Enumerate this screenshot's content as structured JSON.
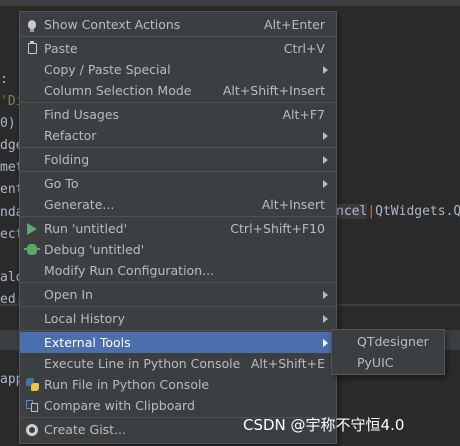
{
  "background": {
    "code_lines": [
      ":",
      "'Di",
      "0)",
      "dge",
      "met",
      "ent",
      "nda",
      "ect",
      "",
      "alo",
      "ed."
    ],
    "right_code": {
      "pre": "ncel",
      "cursor": "|",
      "post": "QtWidgets.Q"
    },
    "bottom_text": "app"
  },
  "menu": {
    "items": [
      {
        "label": "Show Context Actions",
        "shortcut": "Alt+Enter",
        "icon": "bulb-icon"
      },
      {
        "label": "Paste",
        "shortcut": "Ctrl+V",
        "icon": "clipboard-icon"
      },
      {
        "label": "Copy / Paste Special",
        "submenu": true
      },
      {
        "label": "Column Selection Mode",
        "shortcut": "Alt+Shift+Insert"
      },
      {
        "label": "Find Usages",
        "shortcut": "Alt+F7"
      },
      {
        "label": "Refactor",
        "submenu": true
      },
      {
        "label": "Folding",
        "submenu": true
      },
      {
        "label": "Go To",
        "submenu": true
      },
      {
        "label": "Generate...",
        "shortcut": "Alt+Insert"
      },
      {
        "label": "Run 'untitled'",
        "shortcut": "Ctrl+Shift+F10",
        "icon": "run-icon"
      },
      {
        "label": "Debug 'untitled'",
        "icon": "debug-icon"
      },
      {
        "label": "Modify Run Configuration..."
      },
      {
        "label": "Open In",
        "submenu": true
      },
      {
        "label": "Local History",
        "submenu": true
      },
      {
        "label": "External Tools",
        "submenu": true,
        "selected": true
      },
      {
        "label": "Execute Line in Python Console",
        "shortcut": "Alt+Shift+E"
      },
      {
        "label": "Run File in Python Console",
        "icon": "python-icon"
      },
      {
        "label": "Compare with Clipboard",
        "icon": "compare-icon"
      },
      {
        "label": "Create Gist...",
        "icon": "github-icon"
      }
    ]
  },
  "submenu": {
    "items": [
      "QTdesigner",
      "PyUIC"
    ]
  },
  "watermark": "CSDN @宇称不守恒4.0",
  "colors": {
    "selection": "#4b6eaf",
    "menu_background": "#3c3f41",
    "run_green": "#59a869"
  }
}
